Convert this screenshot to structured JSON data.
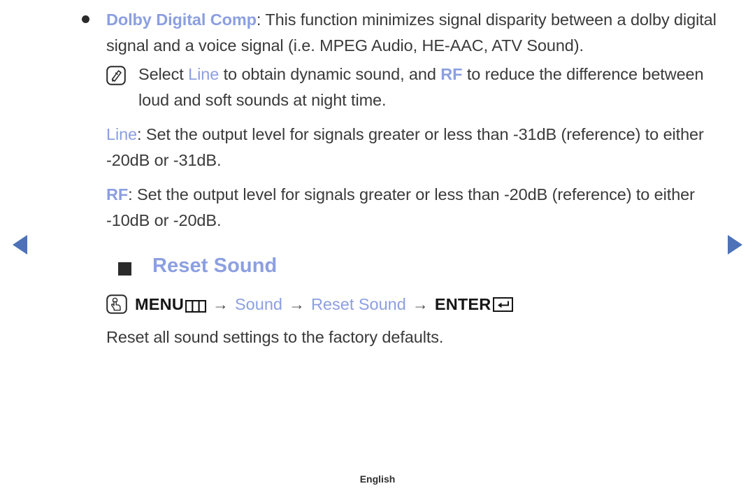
{
  "nav": {
    "prev_label": "Previous page",
    "next_label": "Next page",
    "arrow_color": "#4e72b8"
  },
  "theme": {
    "accent_blue": "#8c9fe0",
    "text_color": "#3a3a3a",
    "bullet_color": "#2b2b2b"
  },
  "bullet_item": {
    "term": "Dolby Digital Comp",
    "text_after_term": ": This function minimizes signal disparity between a dolby digital signal and a voice signal (i.e. MPEG Audio, HE-AAC, ATV Sound)."
  },
  "note": {
    "icon": "note-pencil-icon",
    "part1": "Select ",
    "keyword1": "Line",
    "part2": " to obtain dynamic sound, and ",
    "keyword2": "RF",
    "part3": " to reduce the difference between loud and soft sounds at night time."
  },
  "paragraphs": [
    {
      "keyword": "Line",
      "text": ": Set the output level for signals greater or less than -31dB (reference) to either -20dB or -31dB."
    },
    {
      "keyword": "RF",
      "text": ": Set the output level for signals greater or less than -20dB (reference) to either -10dB or -20dB."
    }
  ],
  "section": {
    "bullet_icon": "square-bullet-icon",
    "title": "Reset Sound",
    "menu_path": {
      "icon": "hand-press-button-icon",
      "menu_label": "MENU",
      "menu_glyph": "menu-button-glyph",
      "separator": "→",
      "step1": "Sound",
      "step2": "Reset Sound",
      "enter_label": "ENTER",
      "enter_glyph": "enter-button-glyph"
    },
    "description": "Reset all sound settings to the factory defaults."
  },
  "footer": {
    "language": "English"
  }
}
